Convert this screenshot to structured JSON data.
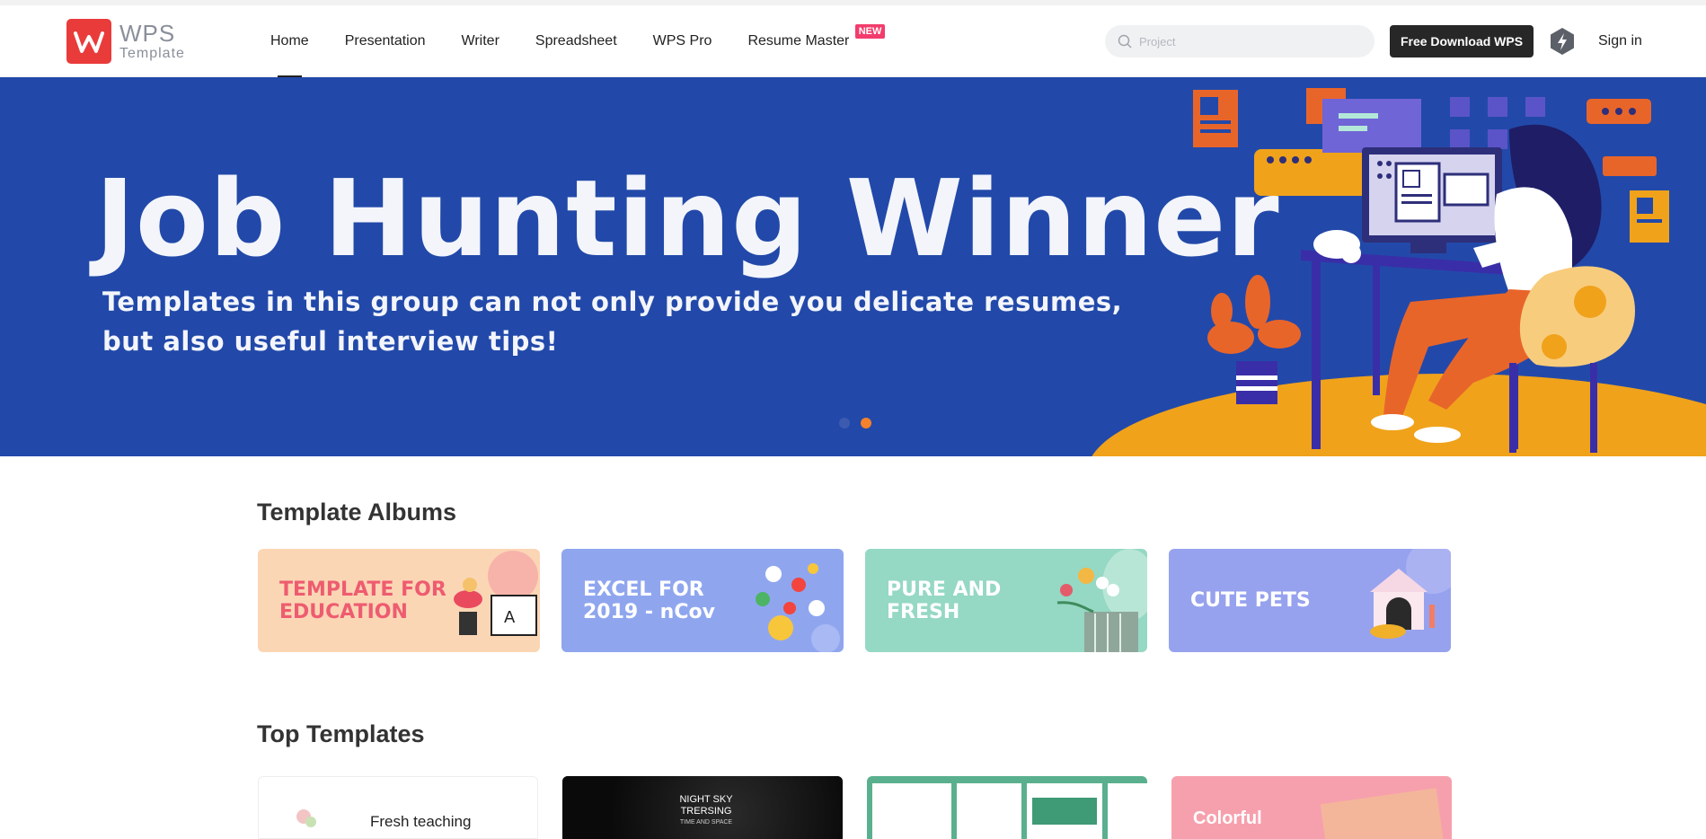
{
  "header": {
    "logo_wordmark": "WPS",
    "logo_subtitle": "Template",
    "nav": [
      {
        "label": "Home",
        "active": true
      },
      {
        "label": "Presentation"
      },
      {
        "label": "Writer"
      },
      {
        "label": "Spreadsheet"
      },
      {
        "label": "WPS Pro"
      },
      {
        "label": "Resume Master",
        "badge": "NEW"
      }
    ],
    "search_placeholder": "Project",
    "download_label": "Free Download WPS",
    "signin_label": "Sign in"
  },
  "banner": {
    "title": "Job Hunting Winner",
    "subtitle_line1": "Templates in this group can not only provide you delicate resumes,",
    "subtitle_line2": "but also useful interview tips!",
    "slides": 2,
    "active_slide": 2,
    "background": "#2249a9",
    "accent": "#f5a623"
  },
  "albums": {
    "title": "Template Albums",
    "items": [
      {
        "label": "TEMPLATE FOR\nEDUCATION",
        "bg": "#fbd6b5",
        "color": "#ee5c70"
      },
      {
        "label": "EXCEL FOR\n2019 - nCov",
        "bg": "#8fa6ef",
        "color": "#ffffff"
      },
      {
        "label": "PURE AND\nFRESH",
        "bg": "#95d8c4",
        "color": "#ffffff"
      },
      {
        "label": "CUTE PETS",
        "bg": "#97a2ee",
        "color": "#ffffff"
      }
    ]
  },
  "top_templates": {
    "title": "Top Templates",
    "items": [
      {
        "label": "Fresh teaching"
      },
      {
        "label": "NIGHT SKY TRERSING",
        "caption": "TIME AND SPACE"
      },
      {
        "label": ""
      },
      {
        "label": "Colorful"
      }
    ]
  }
}
